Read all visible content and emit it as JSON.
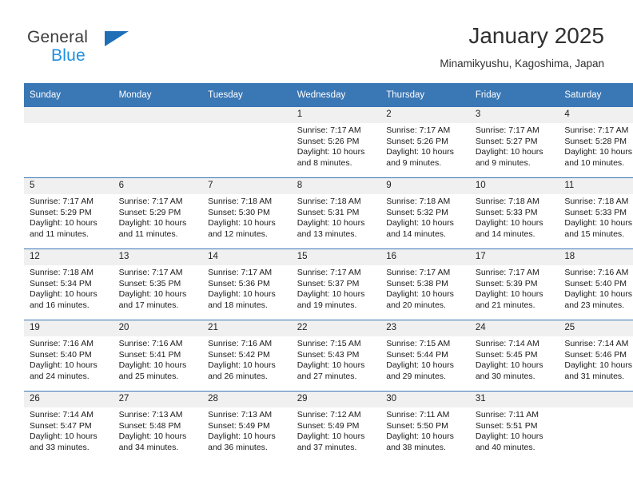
{
  "brand": {
    "line1": "General",
    "line2": "Blue",
    "triangle_color": "#1f6fb6",
    "blue_color": "#1f8fe0"
  },
  "header": {
    "title": "January 2025",
    "subtitle": "Minamikyushu, Kagoshima, Japan"
  },
  "theme": {
    "header_bg": "#3a77b5",
    "daynum_bg": "#f0f0f0",
    "text": "#1a1a1a"
  },
  "weekdays": [
    "Sunday",
    "Monday",
    "Tuesday",
    "Wednesday",
    "Thursday",
    "Friday",
    "Saturday"
  ],
  "weeks": [
    [
      {
        "day": "",
        "sunrise": "",
        "sunset": "",
        "daylight": "",
        "empty": true
      },
      {
        "day": "",
        "sunrise": "",
        "sunset": "",
        "daylight": "",
        "empty": true
      },
      {
        "day": "",
        "sunrise": "",
        "sunset": "",
        "daylight": "",
        "empty": true
      },
      {
        "day": "1",
        "sunrise": "Sunrise: 7:17 AM",
        "sunset": "Sunset: 5:26 PM",
        "daylight": "Daylight: 10 hours and 8 minutes."
      },
      {
        "day": "2",
        "sunrise": "Sunrise: 7:17 AM",
        "sunset": "Sunset: 5:26 PM",
        "daylight": "Daylight: 10 hours and 9 minutes."
      },
      {
        "day": "3",
        "sunrise": "Sunrise: 7:17 AM",
        "sunset": "Sunset: 5:27 PM",
        "daylight": "Daylight: 10 hours and 9 minutes."
      },
      {
        "day": "4",
        "sunrise": "Sunrise: 7:17 AM",
        "sunset": "Sunset: 5:28 PM",
        "daylight": "Daylight: 10 hours and 10 minutes."
      }
    ],
    [
      {
        "day": "5",
        "sunrise": "Sunrise: 7:17 AM",
        "sunset": "Sunset: 5:29 PM",
        "daylight": "Daylight: 10 hours and 11 minutes."
      },
      {
        "day": "6",
        "sunrise": "Sunrise: 7:17 AM",
        "sunset": "Sunset: 5:29 PM",
        "daylight": "Daylight: 10 hours and 11 minutes."
      },
      {
        "day": "7",
        "sunrise": "Sunrise: 7:18 AM",
        "sunset": "Sunset: 5:30 PM",
        "daylight": "Daylight: 10 hours and 12 minutes."
      },
      {
        "day": "8",
        "sunrise": "Sunrise: 7:18 AM",
        "sunset": "Sunset: 5:31 PM",
        "daylight": "Daylight: 10 hours and 13 minutes."
      },
      {
        "day": "9",
        "sunrise": "Sunrise: 7:18 AM",
        "sunset": "Sunset: 5:32 PM",
        "daylight": "Daylight: 10 hours and 14 minutes."
      },
      {
        "day": "10",
        "sunrise": "Sunrise: 7:18 AM",
        "sunset": "Sunset: 5:33 PM",
        "daylight": "Daylight: 10 hours and 14 minutes."
      },
      {
        "day": "11",
        "sunrise": "Sunrise: 7:18 AM",
        "sunset": "Sunset: 5:33 PM",
        "daylight": "Daylight: 10 hours and 15 minutes."
      }
    ],
    [
      {
        "day": "12",
        "sunrise": "Sunrise: 7:18 AM",
        "sunset": "Sunset: 5:34 PM",
        "daylight": "Daylight: 10 hours and 16 minutes."
      },
      {
        "day": "13",
        "sunrise": "Sunrise: 7:17 AM",
        "sunset": "Sunset: 5:35 PM",
        "daylight": "Daylight: 10 hours and 17 minutes."
      },
      {
        "day": "14",
        "sunrise": "Sunrise: 7:17 AM",
        "sunset": "Sunset: 5:36 PM",
        "daylight": "Daylight: 10 hours and 18 minutes."
      },
      {
        "day": "15",
        "sunrise": "Sunrise: 7:17 AM",
        "sunset": "Sunset: 5:37 PM",
        "daylight": "Daylight: 10 hours and 19 minutes."
      },
      {
        "day": "16",
        "sunrise": "Sunrise: 7:17 AM",
        "sunset": "Sunset: 5:38 PM",
        "daylight": "Daylight: 10 hours and 20 minutes."
      },
      {
        "day": "17",
        "sunrise": "Sunrise: 7:17 AM",
        "sunset": "Sunset: 5:39 PM",
        "daylight": "Daylight: 10 hours and 21 minutes."
      },
      {
        "day": "18",
        "sunrise": "Sunrise: 7:16 AM",
        "sunset": "Sunset: 5:40 PM",
        "daylight": "Daylight: 10 hours and 23 minutes."
      }
    ],
    [
      {
        "day": "19",
        "sunrise": "Sunrise: 7:16 AM",
        "sunset": "Sunset: 5:40 PM",
        "daylight": "Daylight: 10 hours and 24 minutes."
      },
      {
        "day": "20",
        "sunrise": "Sunrise: 7:16 AM",
        "sunset": "Sunset: 5:41 PM",
        "daylight": "Daylight: 10 hours and 25 minutes."
      },
      {
        "day": "21",
        "sunrise": "Sunrise: 7:16 AM",
        "sunset": "Sunset: 5:42 PM",
        "daylight": "Daylight: 10 hours and 26 minutes."
      },
      {
        "day": "22",
        "sunrise": "Sunrise: 7:15 AM",
        "sunset": "Sunset: 5:43 PM",
        "daylight": "Daylight: 10 hours and 27 minutes."
      },
      {
        "day": "23",
        "sunrise": "Sunrise: 7:15 AM",
        "sunset": "Sunset: 5:44 PM",
        "daylight": "Daylight: 10 hours and 29 minutes."
      },
      {
        "day": "24",
        "sunrise": "Sunrise: 7:14 AM",
        "sunset": "Sunset: 5:45 PM",
        "daylight": "Daylight: 10 hours and 30 minutes."
      },
      {
        "day": "25",
        "sunrise": "Sunrise: 7:14 AM",
        "sunset": "Sunset: 5:46 PM",
        "daylight": "Daylight: 10 hours and 31 minutes."
      }
    ],
    [
      {
        "day": "26",
        "sunrise": "Sunrise: 7:14 AM",
        "sunset": "Sunset: 5:47 PM",
        "daylight": "Daylight: 10 hours and 33 minutes."
      },
      {
        "day": "27",
        "sunrise": "Sunrise: 7:13 AM",
        "sunset": "Sunset: 5:48 PM",
        "daylight": "Daylight: 10 hours and 34 minutes."
      },
      {
        "day": "28",
        "sunrise": "Sunrise: 7:13 AM",
        "sunset": "Sunset: 5:49 PM",
        "daylight": "Daylight: 10 hours and 36 minutes."
      },
      {
        "day": "29",
        "sunrise": "Sunrise: 7:12 AM",
        "sunset": "Sunset: 5:49 PM",
        "daylight": "Daylight: 10 hours and 37 minutes."
      },
      {
        "day": "30",
        "sunrise": "Sunrise: 7:11 AM",
        "sunset": "Sunset: 5:50 PM",
        "daylight": "Daylight: 10 hours and 38 minutes."
      },
      {
        "day": "31",
        "sunrise": "Sunrise: 7:11 AM",
        "sunset": "Sunset: 5:51 PM",
        "daylight": "Daylight: 10 hours and 40 minutes."
      },
      {
        "day": "",
        "sunrise": "",
        "sunset": "",
        "daylight": "",
        "empty": true
      }
    ]
  ]
}
